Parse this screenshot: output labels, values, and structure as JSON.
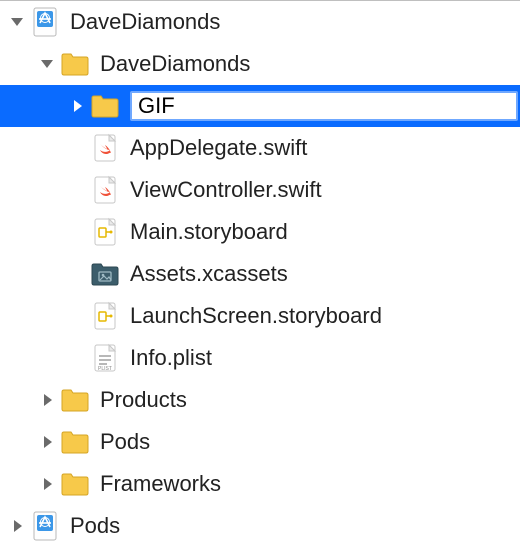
{
  "tree": {
    "root_project": "DaveDiamonds",
    "root_expanded": true,
    "children": [
      {
        "type": "folder",
        "label": "DaveDiamonds",
        "expanded": true,
        "children": [
          {
            "type": "folder",
            "label": "GIF",
            "expanded": false,
            "selected": true,
            "editing": true
          },
          {
            "type": "swift",
            "label": "AppDelegate.swift"
          },
          {
            "type": "swift",
            "label": "ViewController.swift"
          },
          {
            "type": "storyboard",
            "label": "Main.storyboard"
          },
          {
            "type": "xcassets",
            "label": "Assets.xcassets"
          },
          {
            "type": "storyboard",
            "label": "LaunchScreen.storyboard"
          },
          {
            "type": "plist",
            "label": "Info.plist"
          }
        ]
      },
      {
        "type": "folder",
        "label": "Products",
        "expanded": false
      },
      {
        "type": "folder",
        "label": "Pods",
        "expanded": false
      },
      {
        "type": "folder",
        "label": "Frameworks",
        "expanded": false
      }
    ],
    "root_pods": "Pods",
    "root_pods_expanded": false
  },
  "colors": {
    "selection": "#0a6bff",
    "folder_fill": "#f7c94a",
    "folder_stroke": "#d6a524",
    "xcassets_fill": "#3c5d6b",
    "project_tint": "#3b97e8"
  },
  "icons": {
    "project": "xcode-project-icon",
    "folder": "folder-icon",
    "swift": "swift-file-icon",
    "storyboard": "storyboard-file-icon",
    "xcassets": "xcassets-folder-icon",
    "plist": "plist-file-icon"
  }
}
